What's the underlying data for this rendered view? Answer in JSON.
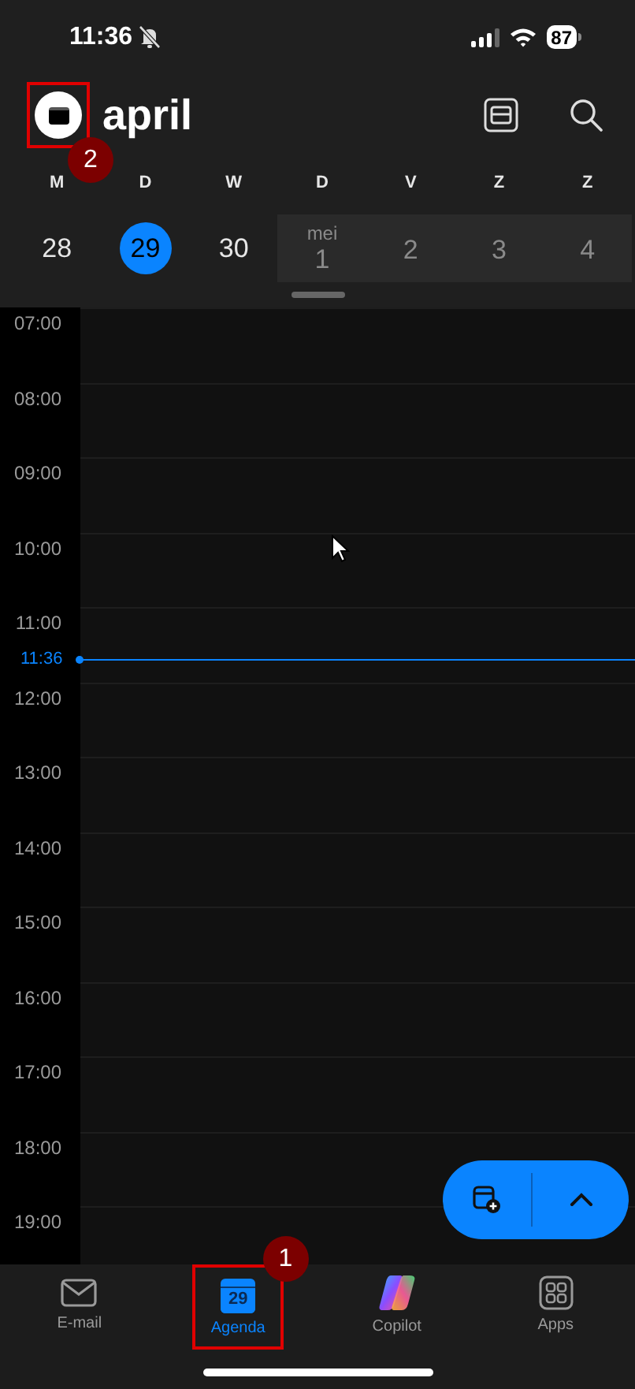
{
  "status_bar": {
    "time": "11:36",
    "battery": "87"
  },
  "header": {
    "title": "april",
    "step_badge": "2"
  },
  "days": [
    {
      "weekday": "M",
      "day": "28",
      "selected": false,
      "next_month": false
    },
    {
      "weekday": "D",
      "day": "29",
      "selected": true,
      "next_month": false
    },
    {
      "weekday": "W",
      "day": "30",
      "selected": false,
      "next_month": false
    },
    {
      "weekday": "D",
      "day": "1",
      "month_label": "mei",
      "selected": false,
      "next_month": true
    },
    {
      "weekday": "V",
      "day": "2",
      "selected": false,
      "next_month": true
    },
    {
      "weekday": "Z",
      "day": "3",
      "selected": false,
      "next_month": true
    },
    {
      "weekday": "Z",
      "day": "4",
      "selected": false,
      "next_month": true
    }
  ],
  "hours": [
    {
      "label": "07:00"
    },
    {
      "label": "08:00"
    },
    {
      "label": "09:00"
    },
    {
      "label": "10:00"
    },
    {
      "label": "11:00",
      "now": "11:36"
    },
    {
      "label": "12:00"
    },
    {
      "label": "13:00"
    },
    {
      "label": "14:00"
    },
    {
      "label": "15:00"
    },
    {
      "label": "16:00"
    },
    {
      "label": "17:00"
    },
    {
      "label": "18:00"
    },
    {
      "label": "19:00"
    }
  ],
  "tab_bar": [
    {
      "kind": "mail",
      "label": "E-mail",
      "selected": false
    },
    {
      "kind": "calendar",
      "label": "Agenda",
      "icon_text": "29",
      "selected": true,
      "step_badge": "1"
    },
    {
      "kind": "copilot",
      "label": "Copilot",
      "selected": false
    },
    {
      "kind": "apps",
      "label": "Apps",
      "selected": false
    }
  ]
}
